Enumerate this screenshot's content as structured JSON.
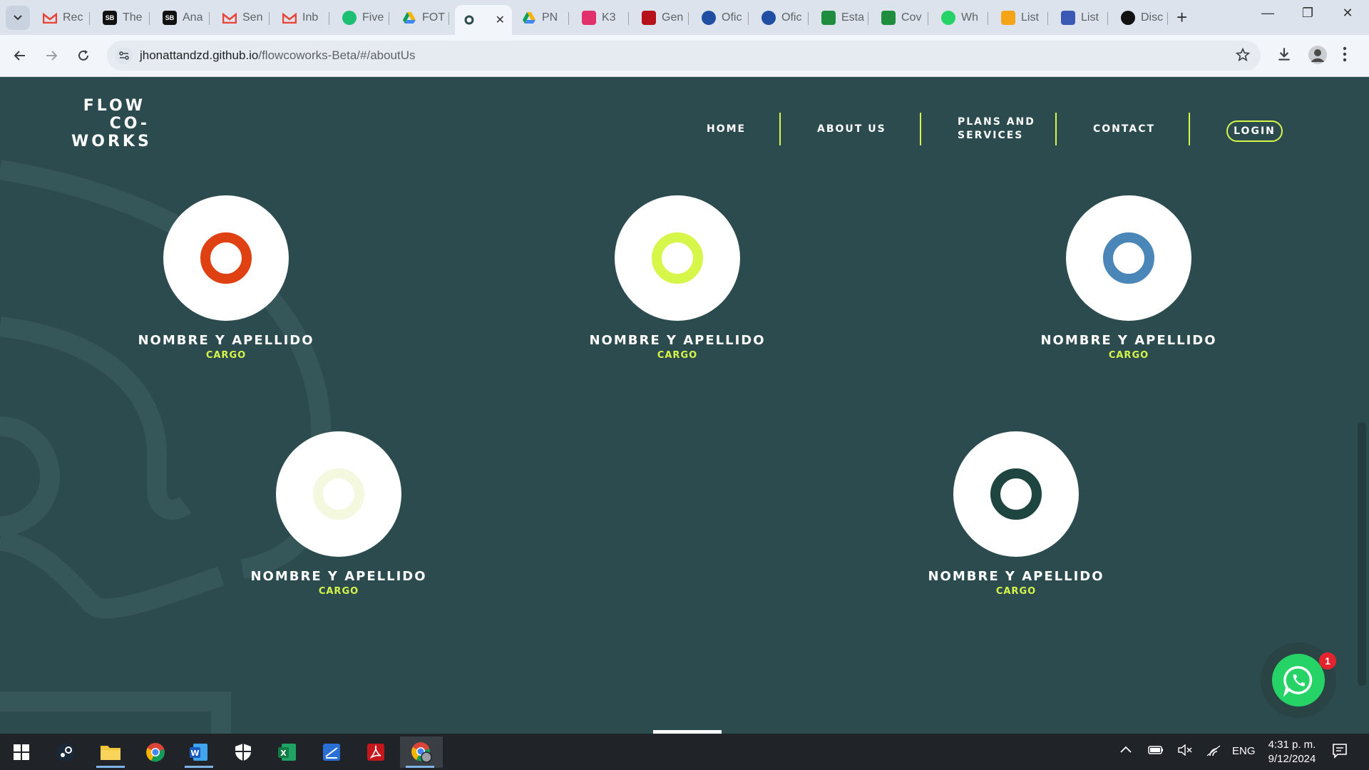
{
  "browser": {
    "tabs": [
      {
        "label": "Rec",
        "icon": "gmail-icon",
        "color": "#ea4335"
      },
      {
        "label": "The",
        "icon": "sb-icon",
        "color": "#111111"
      },
      {
        "label": "Ana",
        "icon": "sb-icon",
        "color": "#111111"
      },
      {
        "label": "Sen",
        "icon": "gmail-icon",
        "color": "#ea4335"
      },
      {
        "label": "Inb",
        "icon": "gmail-icon",
        "color": "#ea4335"
      },
      {
        "label": "Five",
        "icon": "fiverr-icon",
        "color": "#1dbf73"
      },
      {
        "label": "FOT",
        "icon": "drive-icon",
        "color": "#f4b400"
      },
      {
        "label": "",
        "icon": "flow-icon",
        "color": "#2c4b4e",
        "active": true
      },
      {
        "label": "PN",
        "icon": "drive-icon",
        "color": "#f4b400"
      },
      {
        "label": "K3",
        "icon": "instagram-icon",
        "color": "#e1306c"
      },
      {
        "label": "Gen",
        "icon": "gen-icon",
        "color": "#b5121b"
      },
      {
        "label": "Ofic",
        "icon": "blue-circle-icon",
        "color": "#1f4ea3"
      },
      {
        "label": "Ofic",
        "icon": "blue-circle-icon",
        "color": "#1f4ea3"
      },
      {
        "label": "Esta",
        "icon": "sheets-plus-icon",
        "color": "#1e8e3e"
      },
      {
        "label": "Cov",
        "icon": "sheets-plus-icon",
        "color": "#1e8e3e"
      },
      {
        "label": "Wh",
        "icon": "whatsapp-icon",
        "color": "#25d366"
      },
      {
        "label": "List",
        "icon": "notion-icon",
        "color": "#f6a417"
      },
      {
        "label": "List",
        "icon": "pencil-icon",
        "color": "#3a59b5"
      },
      {
        "label": "Disc",
        "icon": "github-icon",
        "color": "#111111"
      }
    ],
    "url_host": "jhonattandzd.github.io",
    "url_path": "/flowcoworks-Beta/#/aboutUs"
  },
  "site": {
    "logo": {
      "line1": "FLOW",
      "line2": "CO-",
      "line3": "WORKS"
    },
    "nav": {
      "home": "HOME",
      "about": "ABOUT US",
      "plans_line1": "PLANS AND",
      "plans_line2": "SERVICES",
      "contact": "CONTACT",
      "login": "LOGIN"
    },
    "accent": "#d7f64a",
    "background": "#2c4b4e",
    "team": [
      {
        "name": "NOMBRE Y APELLIDO",
        "role": "CARGO",
        "ring_color": "#e04112"
      },
      {
        "name": "NOMBRE Y APELLIDO",
        "role": "CARGO",
        "ring_color": "#d7f64a"
      },
      {
        "name": "NOMBRE Y APELLIDO",
        "role": "CARGO",
        "ring_color": "#4a86b8"
      },
      {
        "name": "NOMBRE Y APELLIDO",
        "role": "CARGO",
        "ring_color": "#f3f8de"
      },
      {
        "name": "NOMBRE Y APELLIDO",
        "role": "CARGO",
        "ring_color": "#1f4540"
      }
    ],
    "whatsapp_badge": "1"
  },
  "taskbar": {
    "language": "ENG",
    "time": "4:31 p. m.",
    "date": "9/12/2024"
  }
}
